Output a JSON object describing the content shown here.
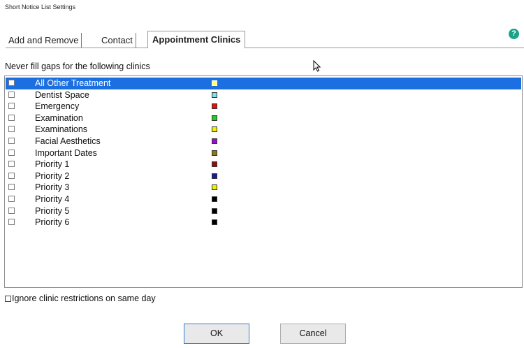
{
  "window": {
    "title": "Short Notice List Settings"
  },
  "tabs": [
    {
      "label": "Add and Remove"
    },
    {
      "label": "Contact"
    },
    {
      "label": "Appointment Clinics"
    }
  ],
  "help_icon_glyph": "?",
  "section_label": "Never fill gaps for the following clinics",
  "clinics": [
    {
      "label": "All Other Treatment",
      "color": "#ffff66",
      "selected": true
    },
    {
      "label": "Dentist Space",
      "color": "#80e0e8"
    },
    {
      "label": "Emergency",
      "color": "#dd1111"
    },
    {
      "label": "Examination",
      "color": "#22cc22"
    },
    {
      "label": "Examinations",
      "color": "#f0f000"
    },
    {
      "label": "Facial Aesthetics",
      "color": "#9911cc"
    },
    {
      "label": "Important Dates",
      "color": "#8a7a10"
    },
    {
      "label": "Priority 1",
      "color": "#8b1010"
    },
    {
      "label": "Priority 2",
      "color": "#1a1a99"
    },
    {
      "label": "Priority 3",
      "color": "#f0f000"
    },
    {
      "label": "Priority 4",
      "color": "#000000"
    },
    {
      "label": "Priority 5",
      "color": "#000000"
    },
    {
      "label": "Priority 6",
      "color": "#000000"
    }
  ],
  "ignore_restrictions": {
    "label": "Ignore clinic restrictions on same day",
    "checked": false
  },
  "buttons": {
    "ok": "OK",
    "cancel": "Cancel"
  }
}
